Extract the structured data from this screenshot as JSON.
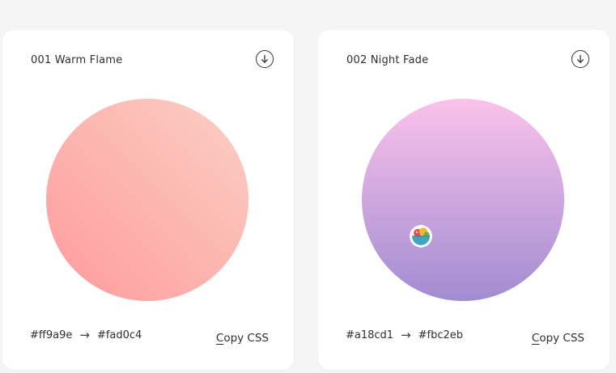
{
  "cards": [
    {
      "title": "001 Warm Flame",
      "from_color": "#ff9a9e",
      "to_color": "#fad0c4",
      "arrow": "→",
      "copy_label": "Copy CSS",
      "download_icon": "download-circle-icon",
      "gradient": {
        "start": "#ff9a9e",
        "end": "#fad0c4",
        "direction": "45deg"
      }
    },
    {
      "title": "002 Night Fade",
      "from_color": "#a18cd1",
      "to_color": "#fbc2eb",
      "arrow": "→",
      "copy_label": "Copy CSS",
      "download_icon": "download-circle-icon",
      "gradient": {
        "start": "#a18cd1",
        "end": "#fbc2eb",
        "direction": "to top"
      }
    }
  ]
}
